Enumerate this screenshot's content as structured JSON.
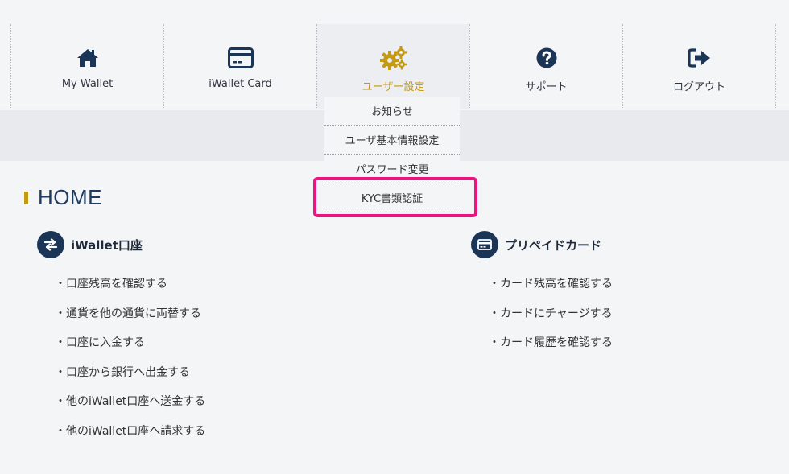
{
  "nav": {
    "items": [
      {
        "label": "My Wallet",
        "icon": "home-icon"
      },
      {
        "label": "iWallet Card",
        "icon": "credit-card-icon"
      },
      {
        "label": "ユーザー設定",
        "icon": "gears-icon"
      },
      {
        "label": "サポート",
        "icon": "question-circle-icon"
      },
      {
        "label": "ログアウト",
        "icon": "sign-out-icon"
      }
    ],
    "active_color": "#c49a12"
  },
  "dropdown": {
    "items": [
      "お知らせ",
      "ユーザ基本情報設定",
      "パスワード変更",
      "KYC書類認証"
    ],
    "highlight_color": "#f0127f"
  },
  "page_title": "HOME",
  "sections": {
    "account": {
      "title": "iWallet口座",
      "icon": "exchange-arrows-icon",
      "links": [
        "・口座残高を確認する",
        "・通貨を他の通貨に両替する",
        "・口座に入金する",
        "・口座から銀行へ出金する",
        "・他のiWallet口座へ送金する",
        "・他のiWallet口座へ請求する"
      ]
    },
    "card": {
      "title": "プリペイドカード",
      "icon": "credit-card-icon",
      "links": [
        "・カード残高を確認する",
        "・カードにチャージする",
        "・カード履歴を確認する"
      ]
    }
  },
  "colors": {
    "navy": "#1a3556",
    "accent": "#c49a12"
  }
}
